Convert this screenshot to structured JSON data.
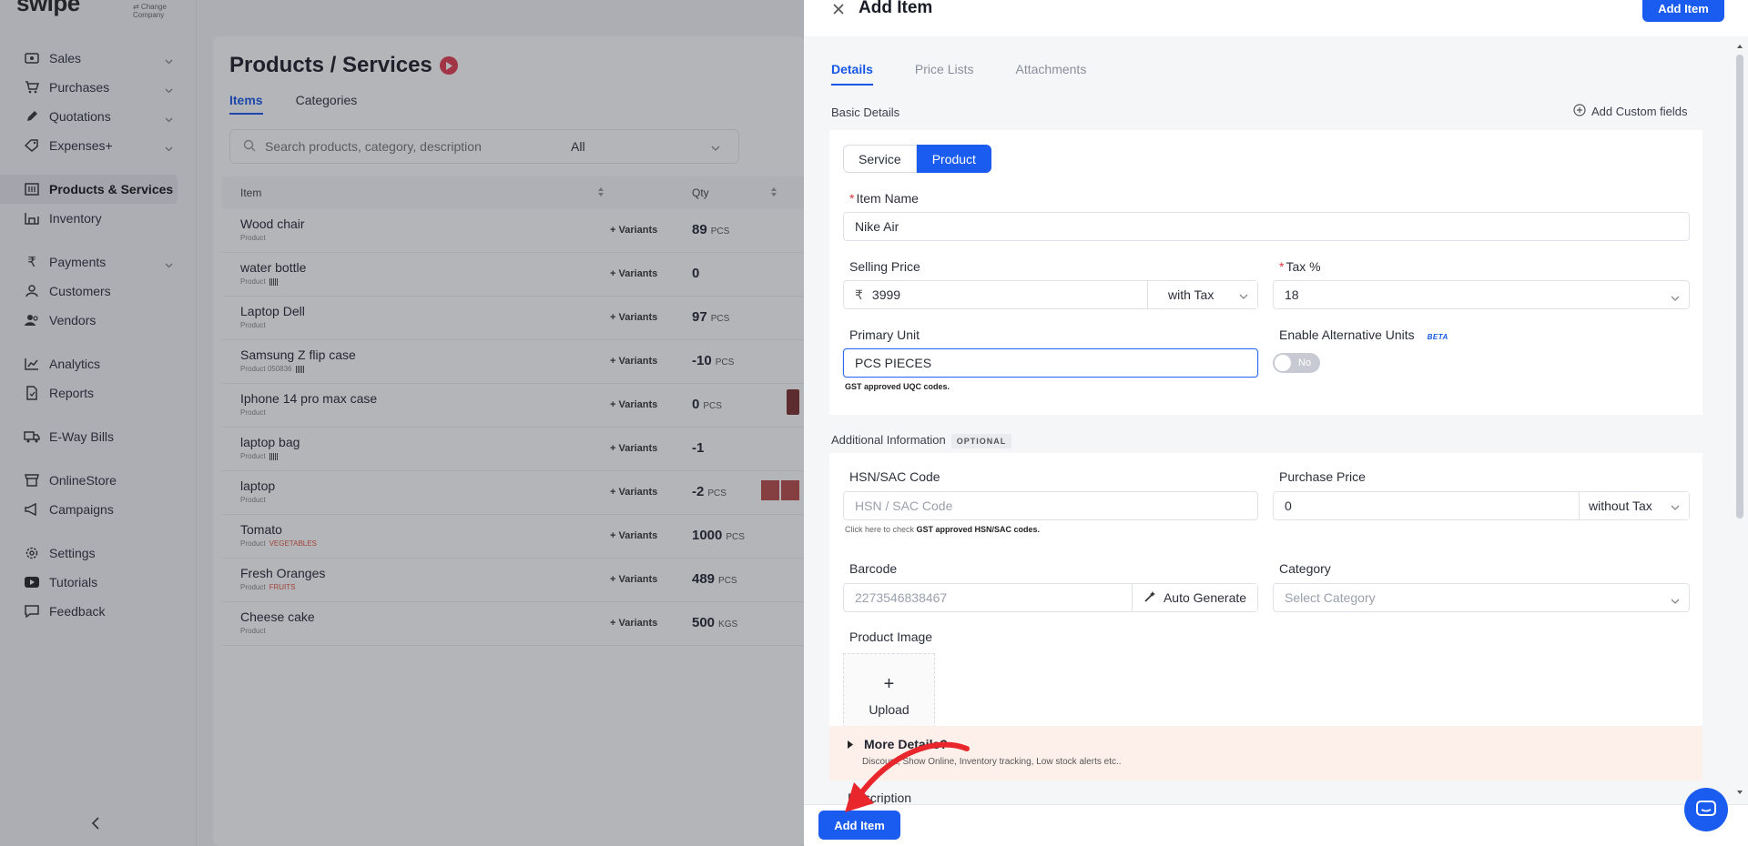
{
  "brand": {
    "name": "swipe",
    "sub": "⇄ Change Company"
  },
  "sidebar": {
    "items": [
      {
        "label": "Sales",
        "icon": "sales-icon",
        "chev": true
      },
      {
        "label": "Purchases",
        "icon": "cart-icon",
        "chev": true
      },
      {
        "label": "Quotations",
        "icon": "pen-icon",
        "chev": true
      },
      {
        "label": "Expenses+",
        "icon": "tag-icon",
        "chev": true
      },
      {
        "label": "Products & Services",
        "icon": "box-icon",
        "active": true
      },
      {
        "label": "Inventory",
        "icon": "inventory-icon"
      },
      {
        "label": "Payments",
        "icon": "rupee-icon",
        "chev": true
      },
      {
        "label": "Customers",
        "icon": "user-icon"
      },
      {
        "label": "Vendors",
        "icon": "users-icon"
      },
      {
        "label": "Analytics",
        "icon": "chart-icon"
      },
      {
        "label": "Reports",
        "icon": "report-icon"
      },
      {
        "label": "E-Way Bills",
        "icon": "truck-icon"
      },
      {
        "label": "OnlineStore",
        "icon": "store-icon"
      },
      {
        "label": "Campaigns",
        "icon": "megaphone-icon"
      },
      {
        "label": "Settings",
        "icon": "gear-icon"
      },
      {
        "label": "Tutorials",
        "icon": "youtube-icon"
      },
      {
        "label": "Feedback",
        "icon": "message-icon"
      }
    ]
  },
  "main": {
    "title": "Products / Services",
    "tabs": [
      {
        "label": "Items",
        "active": true
      },
      {
        "label": "Categories"
      }
    ],
    "search_placeholder": "Search products, category, description",
    "filter": "All",
    "columns": [
      "Item",
      "Qty"
    ],
    "variants_label": "+ Variants",
    "rows": [
      {
        "name": "Wood chair",
        "type": "Product",
        "qty": "89",
        "unit": "PCS"
      },
      {
        "name": "water bottle",
        "type": "Product",
        "qty": "0",
        "unit": "",
        "barcode": true
      },
      {
        "name": "Laptop Dell",
        "type": "Product",
        "qty": "97",
        "unit": "PCS"
      },
      {
        "name": "Samsung Z flip case",
        "type": "Product",
        "code": "050836",
        "qty": "-10",
        "unit": "PCS",
        "barcode": true
      },
      {
        "name": "Iphone 14 pro max case",
        "type": "Product",
        "qty": "0",
        "unit": "PCS",
        "img": 1
      },
      {
        "name": "laptop bag",
        "type": "Product",
        "qty": "-1",
        "unit": "",
        "barcode": true
      },
      {
        "name": "laptop",
        "type": "Product",
        "qty": "-2",
        "unit": "PCS",
        "img": 2
      },
      {
        "name": "Tomato",
        "type": "Product",
        "cat": "VEGETABLES",
        "qty": "1000",
        "unit": "PCS"
      },
      {
        "name": "Fresh Oranges",
        "type": "Product",
        "cat": "FRUITS",
        "qty": "489",
        "unit": "PCS"
      },
      {
        "name": "Cheese cake",
        "type": "Product",
        "qty": "500",
        "unit": "KGS"
      }
    ]
  },
  "drawer": {
    "title": "Add Item",
    "top_button": "Add Item",
    "tabs": [
      {
        "label": "Details",
        "active": true
      },
      {
        "label": "Price Lists"
      },
      {
        "label": "Attachments"
      }
    ],
    "basic_details": "Basic Details",
    "add_custom_fields": "Add Custom fields",
    "type_options": [
      "Service",
      "Product"
    ],
    "item_name": {
      "label": "Item Name",
      "value": "Nike Air"
    },
    "selling_price": {
      "label": "Selling Price",
      "currency": "₹",
      "value": "3999",
      "tax_mode": "with Tax"
    },
    "tax": {
      "label": "Tax %",
      "value": "18"
    },
    "primary_unit": {
      "label": "Primary Unit",
      "value": "PCS PIECES",
      "hint": "GST approved UQC codes."
    },
    "alt_units": {
      "label": "Enable Alternative Units",
      "beta": "BETA",
      "toggle": "No"
    },
    "additional_info": "Additional Information",
    "optional": "OPTIONAL",
    "hsn": {
      "label": "HSN/SAC Code",
      "placeholder": "HSN / SAC Code",
      "hint_pre": "Click here to check ",
      "hint_bold": "GST approved HSN/SAC codes."
    },
    "purchase_price": {
      "label": "Purchase Price",
      "value": "0",
      "tax_mode": "without Tax"
    },
    "barcode": {
      "label": "Barcode",
      "placeholder": "2273546838467",
      "auto": "Auto Generate"
    },
    "category": {
      "label": "Category",
      "placeholder": "Select Category"
    },
    "product_image": {
      "label": "Product Image",
      "upload": "Upload",
      "plus": "+"
    },
    "more_details": {
      "title": "More Details?",
      "subtitle": "Discount, Show Online, Inventory tracking, Low stock alerts etc.."
    },
    "description": "Description",
    "footer_button": "Add Item"
  }
}
